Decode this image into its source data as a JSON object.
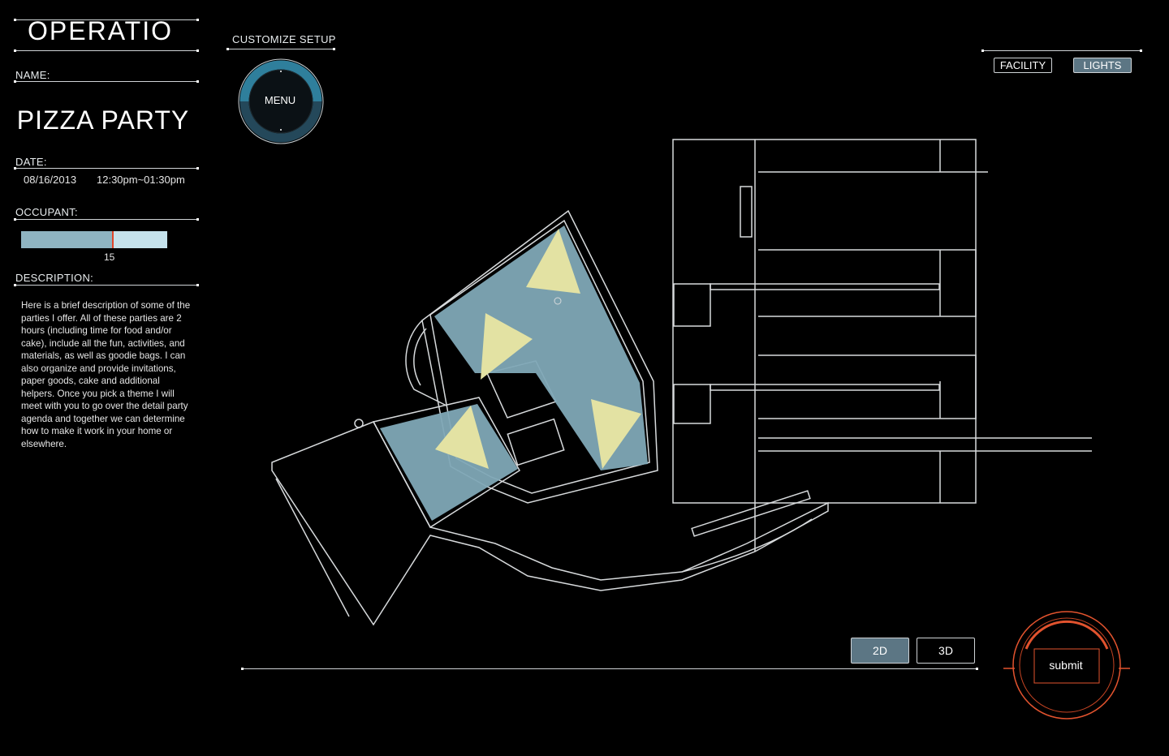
{
  "app": {
    "title": "OPERATIO"
  },
  "sidebar": {
    "name_label": "NAME:",
    "event_name": "PIZZA PARTY",
    "date_label": "DATE:",
    "date": "08/16/2013",
    "time": "12:30pm~01:30pm",
    "occupant_label": "OCCUPANT:",
    "occupant_value": "15",
    "occupant_fraction": 0.63,
    "description_label": "DESCRIPTION:",
    "description": "Here is a brief description of some of the parties I offer. All of these parties are 2 hours (including time for food and/or cake), include all the fun, activities, and materials, as well as goodie bags. I can also organize and provide invitations, paper goods, cake and additional helpers. Once you pick a theme I will meet with you to go over the detail party agenda and together we can determine how to make it work in your home or elsewhere."
  },
  "header": {
    "section_label": "CUSTOMIZE SETUP"
  },
  "menu": {
    "label": "MENU"
  },
  "tabs": [
    {
      "label": "FACILITY",
      "active": false
    },
    {
      "label": "LIGHTS",
      "active": true
    }
  ],
  "view_toggle": [
    {
      "label": "2D",
      "active": true
    },
    {
      "label": "3D",
      "active": false
    }
  ],
  "submit": {
    "label": "submit"
  },
  "colors": {
    "background": "#000000",
    "line": "#d7dadc",
    "room_fill": "#7fa8b6",
    "light_cone": "#e3e2a3",
    "active_tab": "#5c7684",
    "submit_accent": "#e2532e",
    "menu_ring": "#2f7f9c"
  },
  "icons": [
    "menu-dial-icon",
    "submit-dial-icon",
    "light-cone-icon"
  ]
}
